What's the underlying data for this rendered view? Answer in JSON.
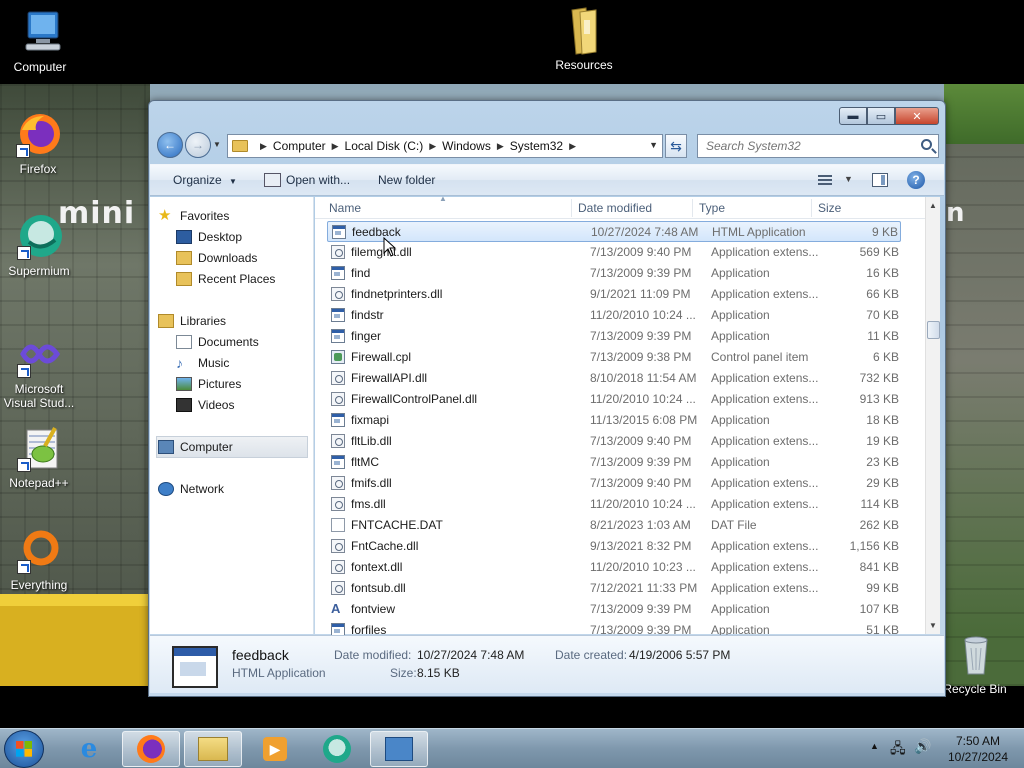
{
  "desktop": {
    "icons": [
      {
        "label": "Computer"
      },
      {
        "label": "Resources"
      },
      {
        "label": "Firefox"
      },
      {
        "label": "Supermium"
      },
      {
        "label": "Microsoft Visual Stud..."
      },
      {
        "label": "Notepad++"
      },
      {
        "label": "Everything"
      },
      {
        "label": "Recycle Bin"
      }
    ],
    "wallpaper_text_left": "mini",
    "wallpaper_text_right": "n"
  },
  "window": {
    "address": {
      "crumbs": [
        "Computer",
        "Local Disk (C:)",
        "Windows",
        "System32"
      ]
    },
    "search": {
      "placeholder": "Search System32"
    },
    "toolbar": {
      "organize": "Organize",
      "open_with": "Open with...",
      "new_folder": "New folder"
    },
    "nav": {
      "favorites": "Favorites",
      "desktop": "Desktop",
      "downloads": "Downloads",
      "recent_places": "Recent Places",
      "libraries": "Libraries",
      "documents": "Documents",
      "music": "Music",
      "pictures": "Pictures",
      "videos": "Videos",
      "computer": "Computer",
      "network": "Network"
    },
    "columns": {
      "name": "Name",
      "date": "Date modified",
      "type": "Type",
      "size": "Size"
    },
    "files": [
      {
        "name": "feedback",
        "date": "10/27/2024 7:48 AM",
        "type": "HTML Application",
        "size": "9 KB",
        "icon": "app"
      },
      {
        "name": "filemgmt.dll",
        "date": "7/13/2009 9:40 PM",
        "type": "Application extens...",
        "size": "569 KB",
        "icon": "dll"
      },
      {
        "name": "find",
        "date": "7/13/2009 9:39 PM",
        "type": "Application",
        "size": "16 KB",
        "icon": "app"
      },
      {
        "name": "findnetprinters.dll",
        "date": "9/1/2021 11:09 PM",
        "type": "Application extens...",
        "size": "66 KB",
        "icon": "dll"
      },
      {
        "name": "findstr",
        "date": "11/20/2010 10:24 ...",
        "type": "Application",
        "size": "70 KB",
        "icon": "app"
      },
      {
        "name": "finger",
        "date": "7/13/2009 9:39 PM",
        "type": "Application",
        "size": "11 KB",
        "icon": "app"
      },
      {
        "name": "Firewall.cpl",
        "date": "7/13/2009 9:38 PM",
        "type": "Control panel item",
        "size": "6 KB",
        "icon": "cpl"
      },
      {
        "name": "FirewallAPI.dll",
        "date": "8/10/2018 11:54 AM",
        "type": "Application extens...",
        "size": "732 KB",
        "icon": "dll"
      },
      {
        "name": "FirewallControlPanel.dll",
        "date": "11/20/2010 10:24 ...",
        "type": "Application extens...",
        "size": "913 KB",
        "icon": "dll"
      },
      {
        "name": "fixmapi",
        "date": "11/13/2015 6:08 PM",
        "type": "Application",
        "size": "18 KB",
        "icon": "app"
      },
      {
        "name": "fltLib.dll",
        "date": "7/13/2009 9:40 PM",
        "type": "Application extens...",
        "size": "19 KB",
        "icon": "dll"
      },
      {
        "name": "fltMC",
        "date": "7/13/2009 9:39 PM",
        "type": "Application",
        "size": "23 KB",
        "icon": "app"
      },
      {
        "name": "fmifs.dll",
        "date": "7/13/2009 9:40 PM",
        "type": "Application extens...",
        "size": "29 KB",
        "icon": "dll"
      },
      {
        "name": "fms.dll",
        "date": "11/20/2010 10:24 ...",
        "type": "Application extens...",
        "size": "114 KB",
        "icon": "dll"
      },
      {
        "name": "FNTCACHE.DAT",
        "date": "8/21/2023 1:03 AM",
        "type": "DAT File",
        "size": "262 KB",
        "icon": "dat"
      },
      {
        "name": "FntCache.dll",
        "date": "9/13/2021 8:32 PM",
        "type": "Application extens...",
        "size": "1,156 KB",
        "icon": "dll"
      },
      {
        "name": "fontext.dll",
        "date": "11/20/2010 10:23 ...",
        "type": "Application extens...",
        "size": "841 KB",
        "icon": "dll"
      },
      {
        "name": "fontsub.dll",
        "date": "7/12/2021 11:33 PM",
        "type": "Application extens...",
        "size": "99 KB",
        "icon": "dll"
      },
      {
        "name": "fontview",
        "date": "7/13/2009 9:39 PM",
        "type": "Application",
        "size": "107 KB",
        "icon": "font"
      },
      {
        "name": "forfiles",
        "date": "7/13/2009 9:39 PM",
        "type": "Application",
        "size": "51 KB",
        "icon": "app"
      }
    ],
    "selected_index": 0,
    "details": {
      "name": "feedback",
      "type": "HTML Application",
      "modified_label": "Date modified:",
      "modified_value": "10/27/2024 7:48 AM",
      "size_label": "Size:",
      "size_value": "8.15 KB",
      "created_label": "Date created:",
      "created_value": "4/19/2006 5:57 PM"
    }
  },
  "taskbar": {
    "clock_time": "7:50 AM",
    "clock_date": "10/27/2024"
  }
}
